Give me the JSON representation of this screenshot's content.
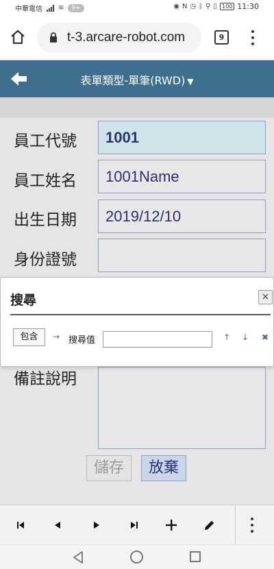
{
  "status_bar": {
    "carrier": "中華電信",
    "notifications": "9+",
    "battery": "100",
    "time": "11:30"
  },
  "browser": {
    "url": "t-3.arcare-robot.com",
    "tab_count": "9"
  },
  "header": {
    "title": "表單類型-單筆(RWD)",
    "dropdown_icon": "chevron-down-icon",
    "back_icon": "arrow-left-icon"
  },
  "form": {
    "fields": [
      {
        "label": "員工代號",
        "value": "1001"
      },
      {
        "label": "員工姓名",
        "value": "1001Name"
      },
      {
        "label": "出生日期",
        "value": "2019/12/10"
      },
      {
        "label": "身份證號",
        "value": ""
      }
    ],
    "memo_label": "備註說明",
    "memo_value": "",
    "save_label": "儲存",
    "cancel_label": "放棄"
  },
  "search_popup": {
    "title": "搜尋",
    "close_label": "×",
    "mode_label": "包含",
    "arrow_label": "→",
    "value_label": "搜尋值",
    "value": "",
    "up_label": "↑",
    "down_label": "↓",
    "clear_label": "✖"
  },
  "colors": {
    "header_bg": "#3f6f8f",
    "active_field_bg": "#cfe3ea",
    "field_text": "#2b3170"
  }
}
